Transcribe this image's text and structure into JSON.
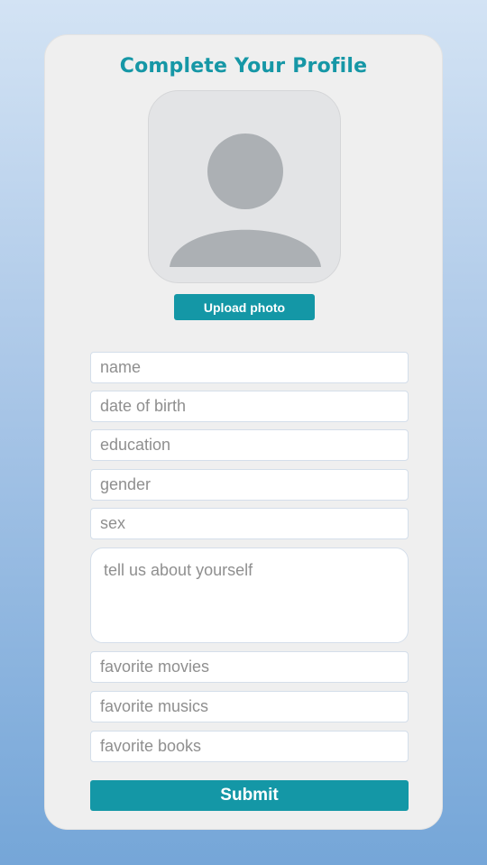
{
  "title": "Complete Your Profile",
  "avatar": {
    "icon": "user-silhouette-icon"
  },
  "upload_label": "Upload photo",
  "fields": {
    "name": "name",
    "dob": "date of birth",
    "education": "education",
    "gender": "gender",
    "sex": "sex",
    "about": "tell us about yourself",
    "movies": "favorite movies",
    "musics": "favorite musics",
    "books": "favorite books"
  },
  "submit_label": "Submit",
  "colors": {
    "accent": "#1497a6",
    "card": "#efefef",
    "avatar_bg": "#e3e4e6",
    "avatar_icon": "#acb0b4"
  }
}
